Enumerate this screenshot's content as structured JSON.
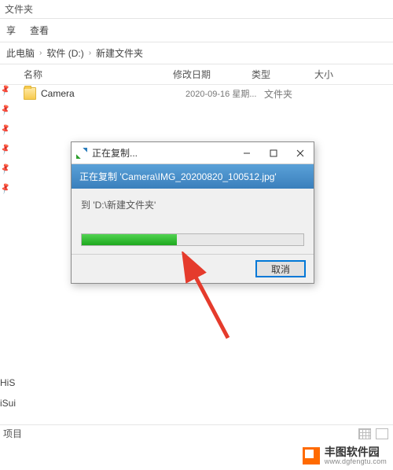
{
  "titlebar": {
    "title": "文件夹"
  },
  "menubar": {
    "share": "享",
    "view": "查看"
  },
  "breadcrumb": {
    "items": [
      "此电脑",
      "软件 (D:)",
      "新建文件夹"
    ]
  },
  "columns": {
    "name": "名称",
    "date": "修改日期",
    "type": "类型",
    "size": "大小"
  },
  "files": [
    {
      "name": "Camera",
      "date": "2020-09-16 星期...",
      "type": "文件夹"
    }
  ],
  "sidebar_labels": {
    "his": "HiS",
    "isui": "iSui"
  },
  "footer": {
    "status": "项目"
  },
  "dialog": {
    "title": "正在复制...",
    "bluebar": "正在复制 'Camera\\IMG_20200820_100512.jpg'",
    "destination": "到 'D:\\新建文件夹'",
    "progress_percent": 43,
    "cancel": "取消"
  },
  "watermark": {
    "brand": "丰图软件园",
    "url": "www.dgfengtu.com"
  }
}
